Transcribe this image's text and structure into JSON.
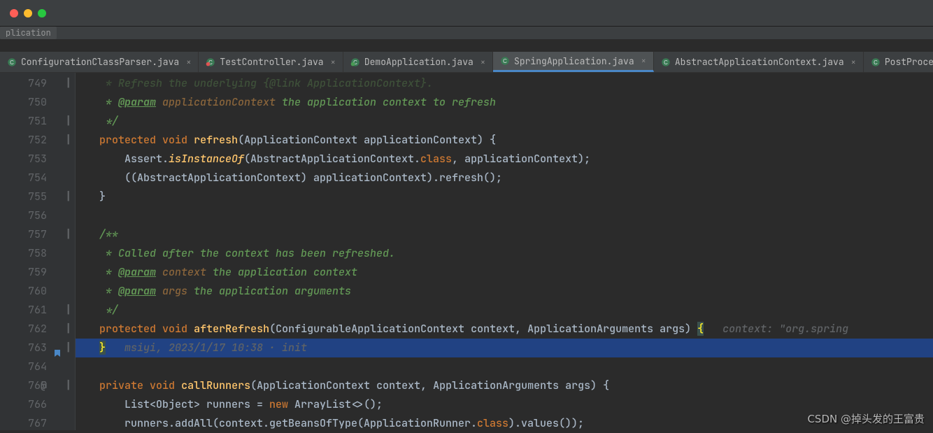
{
  "breadcrumb": "plication",
  "tabs": [
    {
      "label": "ConfigurationClassParser.java",
      "active": false,
      "iconColor": "#519aba"
    },
    {
      "label": "TestController.java",
      "active": false,
      "iconColor": "#519aba",
      "badge": "red"
    },
    {
      "label": "DemoApplication.java",
      "active": false,
      "iconColor": "#519aba",
      "badge": "green"
    },
    {
      "label": "SpringApplication.java",
      "active": true,
      "iconColor": "#519aba"
    },
    {
      "label": "AbstractApplicationContext.java",
      "active": false,
      "iconColor": "#519aba"
    },
    {
      "label": "PostProcess",
      "active": false,
      "iconColor": "#519aba",
      "cut": true
    }
  ],
  "gutter": {
    "lines": [
      "749",
      "750",
      "751",
      "752",
      "753",
      "754",
      "755",
      "756",
      "757",
      "758",
      "759",
      "760",
      "761",
      "762",
      "763",
      "764",
      "765",
      "766",
      "767"
    ],
    "atLine": "765"
  },
  "code": {
    "l749": " * Refresh the underlying {@link ApplicationContext}.",
    "l750_pre": " * ",
    "l750_tag": "@param",
    "l750_pn": " applicationContext",
    "l750_txt": " the application context to refresh",
    "l751": " */",
    "l752_kw1": "protected",
    "l752_kw2": "void",
    "l752_fn": "refresh",
    "l752_sig": "(ApplicationContext applicationContext) {",
    "l753_pre": "    Assert.",
    "l753_m": "isInstanceOf",
    "l753_a": "(AbstractApplicationContext.",
    "l753_cls": "class",
    "l753_b": ", applicationContext);",
    "l754": "    ((AbstractApplicationContext) applicationContext).refresh();",
    "l755": "}",
    "l757": "/**",
    "l758": " * Called after the context has been refreshed.",
    "l759_pre": " * ",
    "l759_tag": "@param",
    "l759_pn": " context",
    "l759_txt": " the application context",
    "l760_pre": " * ",
    "l760_tag": "@param",
    "l760_pn": " args",
    "l760_txt": " the application arguments",
    "l761": " */",
    "l762_kw1": "protected",
    "l762_kw2": "void",
    "l762_fn": "afterRefresh",
    "l762_sig1": "(ConfigurableApplicationContext ",
    "l762_p1": "context",
    "l762_sig2": ", ApplicationArguments ",
    "l762_p2": "args",
    "l762_sig3": ") ",
    "l762_br": "{",
    "l762_hint": "   context: \"org.spring",
    "l763_br": "}",
    "l763_hint": "   msiyi, 2023/1/17 10:38 · init",
    "l765_kw1": "private",
    "l765_kw2": "void",
    "l765_fn": "callRunners",
    "l765_sig": "(ApplicationContext context, ApplicationArguments args) {",
    "l766_a": "    List<Object> runners = ",
    "l766_new": "new",
    "l766_b": " ArrayList<>();",
    "l767_a": "    runners.addAll(context.getBeansOfType(ApplicationRunner.",
    "l767_cls": "class",
    "l767_b": ").values());"
  },
  "watermark": "CSDN @掉头发的王富贵"
}
